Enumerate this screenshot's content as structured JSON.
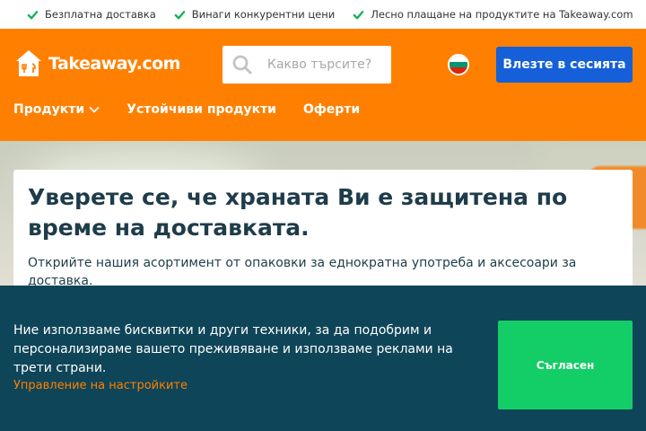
{
  "usp": {
    "items": [
      {
        "label": "Безплатна доставка"
      },
      {
        "label": "Винаги конкурентни цени"
      },
      {
        "label": "Лесно плащане на продуктите на Takeaway.com"
      }
    ]
  },
  "header": {
    "logo_text": "Takeaway.com",
    "search_placeholder": "Какво търсите?",
    "login_label": "Влезте в сесията",
    "nav": [
      {
        "label": "Продукти",
        "has_dropdown": true
      },
      {
        "label": "Устойчиви продукти"
      },
      {
        "label": "Оферти"
      }
    ]
  },
  "hero": {
    "title": "Уверете се, че храната Ви е защитена по време на доставката.",
    "text": "Открийте нашия асортимент от опаковки за еднократна употреба и аксесоари за доставка."
  },
  "cookie": {
    "text": "Ние използваме бисквитки и други техники, за да подобрим и персонализираме вашето преживяване и използваме реклами на трети страни.",
    "link": "Управление на настройките",
    "accept_label": "Съгласен"
  },
  "colors": {
    "brand_orange": "#ff8000",
    "login_blue": "#1560d9",
    "banner_dark": "#0f4558",
    "accept_green": "#13ce66",
    "check_green": "#17b35a"
  },
  "icons": {
    "usp": "check-icon",
    "logo": "takeaway-house-icon",
    "search": "search-icon",
    "flag": "bulgaria-flag-icon",
    "dropdown": "chevron-down-icon"
  }
}
